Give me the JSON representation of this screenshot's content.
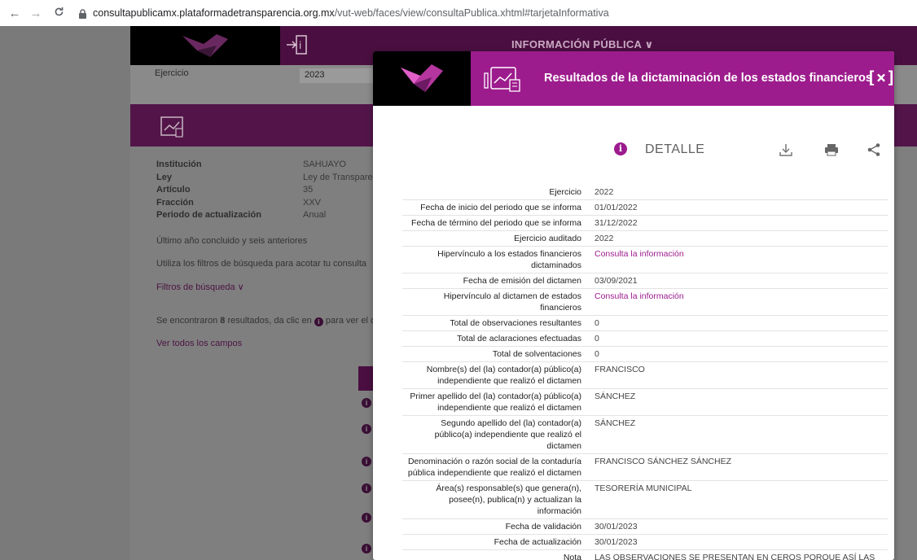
{
  "browser": {
    "back": "←",
    "forward": "→",
    "reload": "C",
    "url_host": "consultapublicamx.plataformadetransparencia.org.mx",
    "url_path": "/vut-web/faces/view/consultaPublica.xhtml#tarjetaInformativa"
  },
  "page": {
    "nav_title": "INFORMACIÓN PÚBLICA ∨",
    "ejercicio_label": "Ejercicio",
    "ejercicio_value": "2023",
    "info": [
      {
        "label": "Institución",
        "value": "SAHUAYO"
      },
      {
        "label": "Ley",
        "value": "Ley de Transparer"
      },
      {
        "label": "Artículo",
        "value": "35"
      },
      {
        "label": "Fracción",
        "value": "XXV"
      },
      {
        "label": "Periodo de actualización",
        "value": "Anual"
      }
    ],
    "periodo_note": "Último año concluido y seis anteriores",
    "filter_hint": "Utiliza los filtros de búsqueda para acotar tu consulta",
    "filters_link": "Filtros de búsqueda ∨",
    "results_prefix": "Se encontraron ",
    "results_count": "8",
    "results_mid": " resultados, da clic en ",
    "results_suffix": " para ver el d",
    "see_all": "Ver todos los campos"
  },
  "modal": {
    "title": "Resultados de la dictaminación de los estados financieros",
    "close": "[×]",
    "detail_label": "DETALLE",
    "accent": "#9d1c8d",
    "rows": [
      {
        "label": "Ejercicio",
        "value": "2022"
      },
      {
        "label": "Fecha de inicio del periodo que se informa",
        "value": "01/01/2022"
      },
      {
        "label": "Fecha de término del periodo que se informa",
        "value": "31/12/2022"
      },
      {
        "label": "Ejercicio auditado",
        "value": "2022"
      },
      {
        "label": "Hipervínculo a los estados financieros dictaminados",
        "value": "Consulta la información",
        "link": true
      },
      {
        "label": "Fecha de emisión del dictamen",
        "value": "03/09/2021"
      },
      {
        "label": "Hipervínculo al dictamen de estados financieros",
        "value": "Consulta la información",
        "link": true
      },
      {
        "label": "Total de observaciones resultantes",
        "value": "0"
      },
      {
        "label": "Total de aclaraciones efectuadas",
        "value": "0"
      },
      {
        "label": "Total de solventaciones",
        "value": "0"
      },
      {
        "label": "Nombre(s) del (la) contador(a) público(a) independiente que realizó el dictamen",
        "value": "FRANCISCO"
      },
      {
        "label": "Primer apellido del (la) contador(a) público(a) independiente que realizó el dictamen",
        "value": "SÁNCHEZ"
      },
      {
        "label": "Segundo apellido del (la) contador(a) público(a) independiente que realizó el dictamen",
        "value": "SÁNCHEZ"
      },
      {
        "label": "Denominación o razón social de la contaduría pública independiente que realizó el dictamen",
        "value": "FRANCISCO SÁNCHEZ SÁNCHEZ"
      },
      {
        "label": "Área(s) responsable(s) que genera(n), posee(n), publica(n) y actualizan la información",
        "value": "TESORERÍA MUNICIPAL"
      },
      {
        "label": "Fecha de validación",
        "value": "30/01/2023"
      },
      {
        "label": "Fecha de actualización",
        "value": "30/01/2023"
      },
      {
        "label": "Nota",
        "value": "LAS OBSERVACIONES SE PRESENTAN EN CEROS PORQUE ASÍ LAS EMITE EL SISTEMA, ESTE FORMATO ES ANUAL"
      }
    ]
  }
}
